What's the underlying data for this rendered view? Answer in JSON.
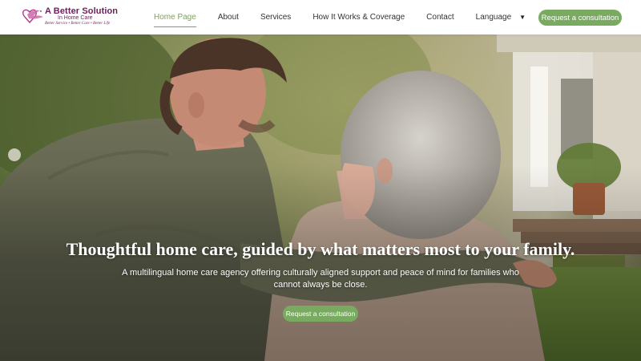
{
  "brand": {
    "name_line1": "A Better Solution",
    "name_line2": "In Home Care",
    "tagline": "Better Service • Better Care • Better Life",
    "logo_icon": "dove-heart-icon"
  },
  "nav": {
    "items": [
      {
        "label": "Home Page",
        "active": true
      },
      {
        "label": "About",
        "active": false
      },
      {
        "label": "Services",
        "active": false
      },
      {
        "label": "How It Works & Coverage",
        "active": false
      },
      {
        "label": "Contact",
        "active": false
      }
    ],
    "language_label": "Language"
  },
  "header_cta": "Request a consultation",
  "hero": {
    "title": "Thoughtful home care, guided by what matters most to your family.",
    "subtitle": "A multilingual home care agency offering culturally aligned support and peace of mind for families who cannot always be close.",
    "cta": "Request a consultation",
    "image_description_icon": "hero-photo"
  },
  "colors": {
    "brand_purple": "#6b1e5c",
    "accent_green": "#78ab5f",
    "active_nav": "#7da25a"
  }
}
